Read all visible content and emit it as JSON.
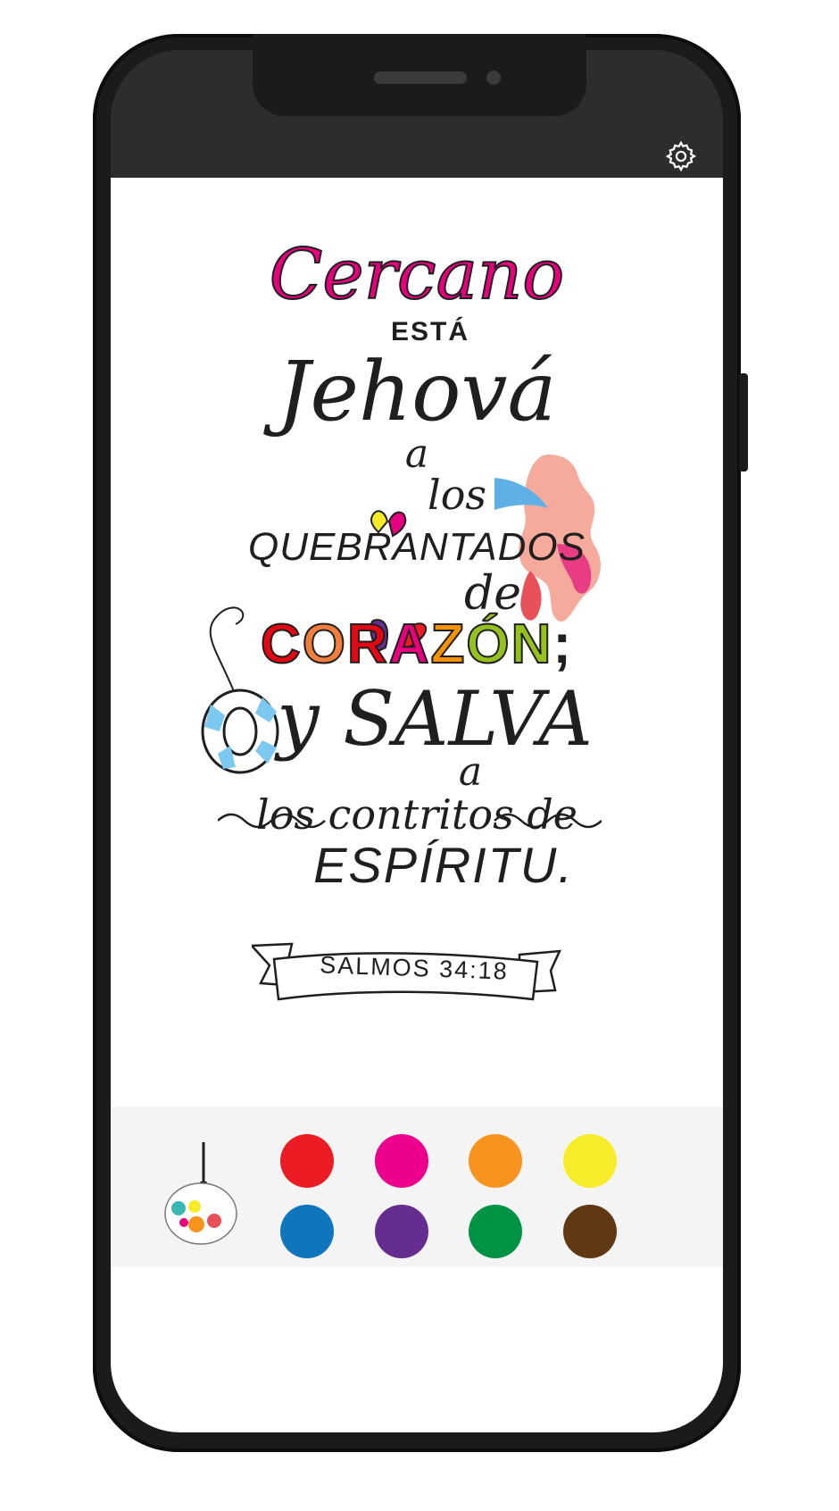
{
  "header": {
    "settings_icon": "gear-icon"
  },
  "artwork": {
    "lines": [
      "Cercano",
      "ESTÁ",
      "Jehová",
      "a",
      "los",
      "QUEBRANTADOS",
      "de",
      "CORAZÓN;",
      "y SALVA",
      "a",
      "los contritos de",
      "ESPÍRITU."
    ],
    "reference": "SALMOS 34:18",
    "corazon_letters": [
      "C",
      "O",
      "R",
      "A",
      "Z",
      "Ó",
      "N"
    ],
    "corazon_colors": [
      "#e30613",
      "#f07f3c",
      "#e30613",
      "#e6007e",
      "#f39200",
      "#95c11f",
      "#95c11f"
    ],
    "highlight_color": "#e6007e"
  },
  "palette": {
    "icon": "paint-palette-icon",
    "colors": [
      {
        "name": "red",
        "hex": "#ed1c24"
      },
      {
        "name": "magenta",
        "hex": "#ec008c"
      },
      {
        "name": "orange",
        "hex": "#f7941d"
      },
      {
        "name": "yellow",
        "hex": "#f7ec2a"
      },
      {
        "name": "blue",
        "hex": "#0f75bc"
      },
      {
        "name": "purple",
        "hex": "#662d91"
      },
      {
        "name": "green",
        "hex": "#009245"
      },
      {
        "name": "brown",
        "hex": "#603913"
      }
    ]
  }
}
